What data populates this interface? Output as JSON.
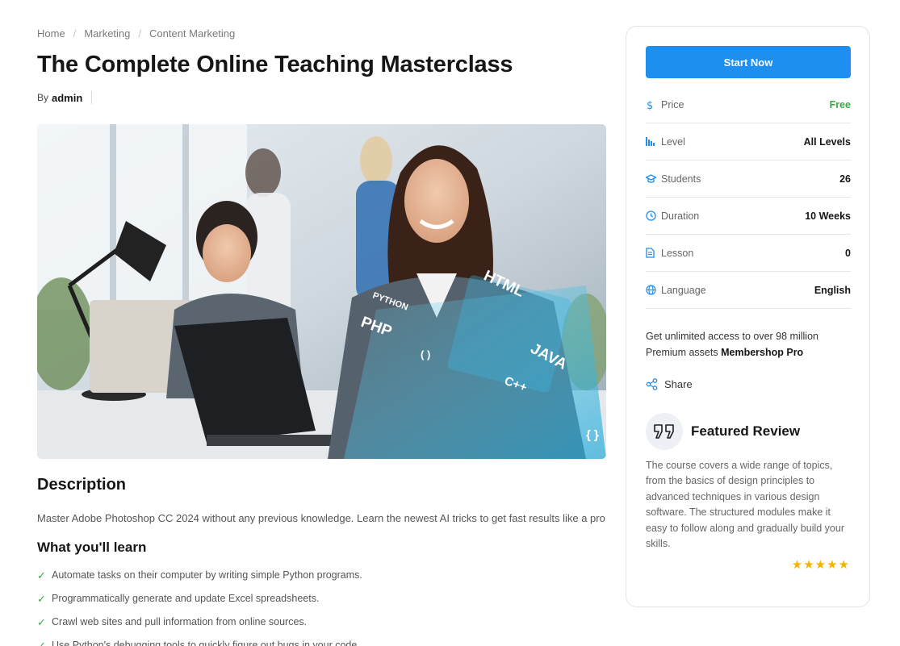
{
  "breadcrumb": {
    "items": [
      "Home",
      "Marketing",
      "Content Marketing"
    ]
  },
  "course": {
    "title": "The Complete Online Teaching Masterclass",
    "by_label": "By",
    "author": "admin"
  },
  "hero": {
    "code_labels": [
      "PYTHON",
      "PHP",
      "HTML",
      "JAVA",
      "C++",
      "{ }",
      "( )"
    ]
  },
  "description": {
    "heading": "Description",
    "text": "Master Adobe Photoshop CC 2024 without any previous knowledge. Learn the newest AI tricks to get fast results like a pro"
  },
  "learn": {
    "heading": "What you'll learn",
    "items": [
      "Automate tasks on their computer by writing simple Python programs.",
      "Programmatically generate and update Excel spreadsheets.",
      "Crawl web sites and pull information from online sources.",
      "Use Python's debugging tools to quickly figure out bugs in your code."
    ]
  },
  "sidebar": {
    "start_button": "Start Now",
    "meta": [
      {
        "icon": "dollar-icon",
        "label": "Price",
        "value": "Free"
      },
      {
        "icon": "bar-chart-icon",
        "label": "Level",
        "value": "All Levels"
      },
      {
        "icon": "graduation-cap-icon",
        "label": "Students",
        "value": "26"
      },
      {
        "icon": "clock-icon",
        "label": "Duration",
        "value": "10 Weeks"
      },
      {
        "icon": "document-icon",
        "label": "Lesson",
        "value": "0"
      },
      {
        "icon": "globe-icon",
        "label": "Language",
        "value": "English"
      }
    ],
    "promo_text": "Get unlimited access to over 98 million Premium assets",
    "promo_brand": "Membershop Pro",
    "share_label": "Share",
    "review": {
      "heading": "Featured Review",
      "text": "The course covers a wide range of topics, from the basics of design principles to advanced techniques in various design software. The structured modules make it easy to follow along and gradually build your skills.",
      "rating": 5,
      "stars": "★★★★★"
    }
  },
  "colors": {
    "accent": "#1d8ff0",
    "success": "#3aa847",
    "star": "#f5b301"
  }
}
